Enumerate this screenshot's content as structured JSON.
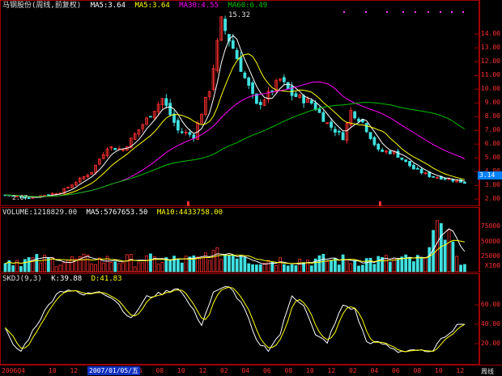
{
  "price": {
    "stock": "马钢股份(周线,前复权)",
    "ma5": "MA5:3.64",
    "ma10": "MA5:3.64",
    "ma30": "MA30:4.55",
    "ma60": "MA60:6.49",
    "high_label": "15.32",
    "low_label": "2.07",
    "current": "3.14",
    "ticks": [
      "14.00",
      "13.00",
      "12.00",
      "11.00",
      "10.00",
      "9.00",
      "8.00",
      "7.00",
      "6.00",
      "5.00",
      "4.00",
      "3.00",
      "2.00"
    ]
  },
  "volume": {
    "label": "VOLUME:1218829.00",
    "ma5": "MA5:5767653.50",
    "ma10": "MA10:4433758.00",
    "ticks": [
      "75000",
      "50000",
      "25000",
      "X100"
    ]
  },
  "kdj": {
    "label": "SKDJ(9,3)",
    "k": "K:39.88",
    "d": "D:41.83",
    "ticks": [
      "60.00",
      "40.00",
      "20.00"
    ]
  },
  "timebar": {
    "start": "2006Q4",
    "selected": "2007/01/05/五",
    "period": "周线",
    "labels": [
      "10",
      "12",
      "02",
      "04",
      "06",
      "08",
      "10",
      "12",
      "02",
      "04",
      "06",
      "08",
      "10",
      "12",
      "02",
      "04",
      "06",
      "08",
      "10",
      "12"
    ]
  },
  "colors": {
    "up": "#ff3030",
    "down": "#40e0e0",
    "ma5": "#ffffff",
    "ma10": "#ffff00",
    "ma30": "#ff00ff",
    "ma60": "#00c000",
    "grid": "#a00000"
  }
}
